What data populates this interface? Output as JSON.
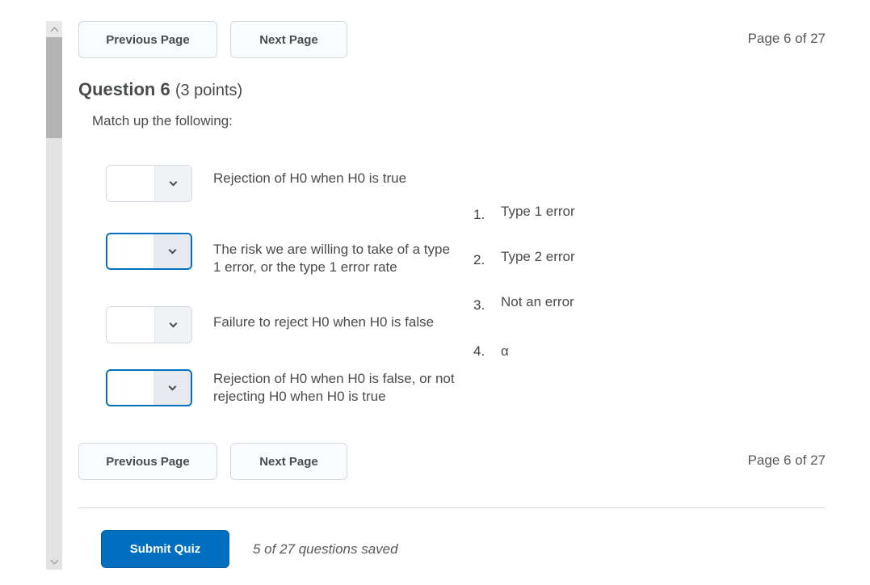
{
  "navigation": {
    "previous_label": "Previous Page",
    "next_label": "Next Page",
    "page_indicator": "Page 6 of 27"
  },
  "question": {
    "number_label": "Question 6",
    "points_label": "(3 points)",
    "prompt": "Match up the following:"
  },
  "matches": [
    {
      "text": "Rejection of H0 when H0 is true",
      "selected": ""
    },
    {
      "text": "The risk we are willing to take of a type 1 error, or the type 1 error rate",
      "selected": ""
    },
    {
      "text": "Failure to reject H0 when H0 is false",
      "selected": ""
    },
    {
      "text": "Rejection of H0 when H0 is false, or not rejecting H0 when H0 is true",
      "selected": ""
    }
  ],
  "choices": [
    {
      "num": "1.",
      "label": "Type 1 error"
    },
    {
      "num": "2.",
      "label": "Type 2 error"
    },
    {
      "num": "3.",
      "label": "Not an error"
    },
    {
      "num": "4.",
      "label": "α"
    }
  ],
  "footer": {
    "submit_label": "Submit Quiz",
    "saved_status": "5 of 27 questions saved"
  },
  "colors": {
    "accent": "#006fbf",
    "text": "#494c4e",
    "border": "#d3d9e3"
  }
}
